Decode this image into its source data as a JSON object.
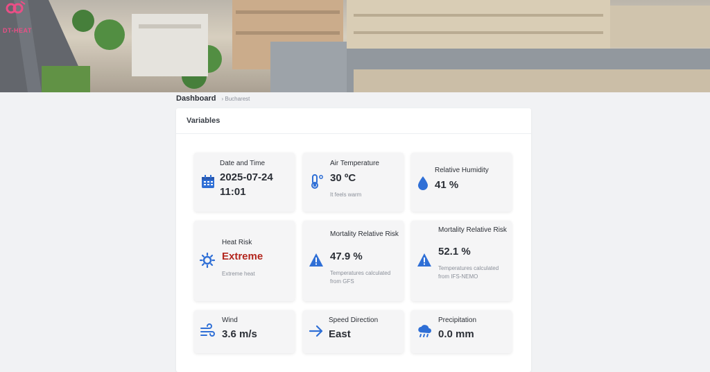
{
  "brand": {
    "logo_text": "DT-HEAT"
  },
  "breadcrumb": {
    "current": "Dashboard",
    "location": "Bucharest"
  },
  "panel": {
    "title": "Variables"
  },
  "cards": {
    "datetime": {
      "label": "Date and Time",
      "value": "2025-07-24 11:01",
      "icon": "calendar-icon"
    },
    "air_temp": {
      "label": "Air Temperature",
      "value": "30 ºC",
      "note": "It feels warm",
      "icon": "thermometer-icon"
    },
    "humidity": {
      "label": "Relative Humidity",
      "value": "41 %",
      "icon": "droplet-icon"
    },
    "heat_risk": {
      "label": "Heat Risk",
      "value": "Extreme",
      "note": "Extreme heat",
      "icon": "sun-icon"
    },
    "mortality_gfs": {
      "label": "Mortality Relative Risk",
      "value": "47.9 %",
      "note": "Temperatures calculated from GFS",
      "icon": "warning-icon"
    },
    "mortality_ifs": {
      "label": "Mortality Relative Risk",
      "value": "52.1 %",
      "note": "Temperatures calculated from IFS-NEMO",
      "icon": "warning-icon"
    },
    "wind": {
      "label": "Wind",
      "value": "3.6 m/s",
      "icon": "wind-icon"
    },
    "direction": {
      "label": "Speed Direction",
      "value": "East",
      "icon": "arrow-right-icon"
    },
    "precip": {
      "label": "Precipitation",
      "value": "0.0 mm",
      "icon": "cloud-rain-icon"
    }
  },
  "colors": {
    "accent": "#2f6fd6",
    "danger": "#b3261e",
    "brand": "#e94f86"
  }
}
